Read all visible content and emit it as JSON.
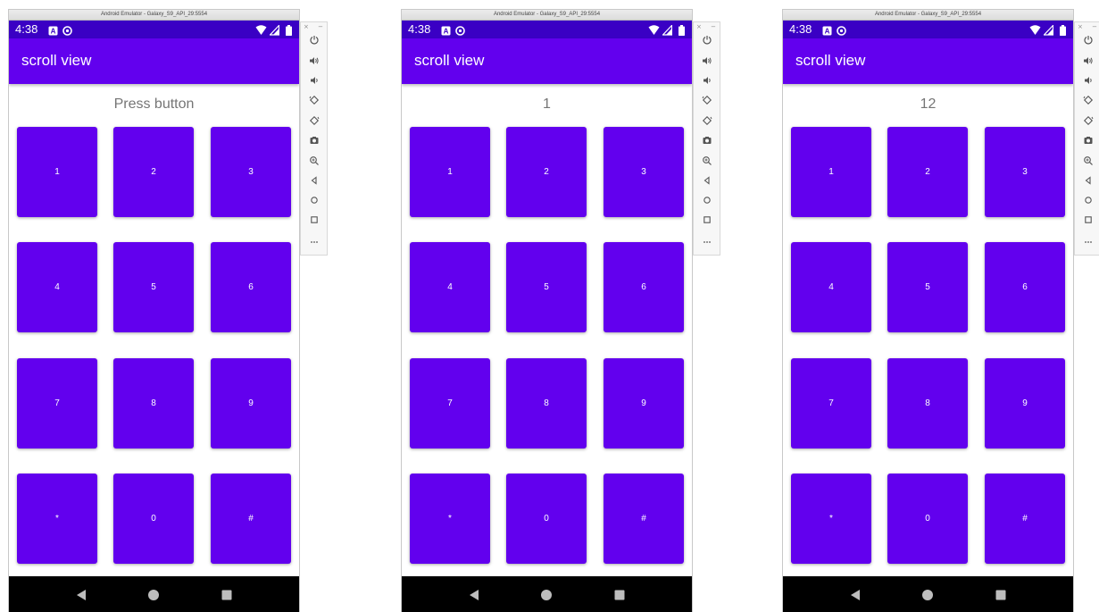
{
  "window_title": "Android Emulator - Galaxy_S9_API_29:5554",
  "status": {
    "time": "4:38",
    "icons": [
      "a-notification-icon",
      "sync-notification-icon",
      "wifi-icon",
      "signal-icon",
      "battery-icon"
    ]
  },
  "app_title": "scroll view",
  "keys": [
    "1",
    "2",
    "3",
    "4",
    "5",
    "6",
    "7",
    "8",
    "9",
    "*",
    "0",
    "#"
  ],
  "screens": [
    {
      "display_text": "Press button"
    },
    {
      "display_text": "1"
    },
    {
      "display_text": "12"
    }
  ],
  "toolbar": {
    "close": "×",
    "minimize": "−",
    "icons": [
      "power-icon",
      "volume-up-icon",
      "volume-down-icon",
      "rotate-left-icon",
      "rotate-right-icon",
      "camera-icon",
      "zoom-icon",
      "back-icon",
      "home-icon",
      "overview-icon",
      "more-icon"
    ]
  },
  "nav": [
    "back-icon",
    "home-icon",
    "recents-icon"
  ],
  "colors": {
    "app_bar": "#6200ee",
    "status_bar": "#3a00c4",
    "key": "#6200ee",
    "display_text": "#757575",
    "nav_bar": "#000000"
  }
}
